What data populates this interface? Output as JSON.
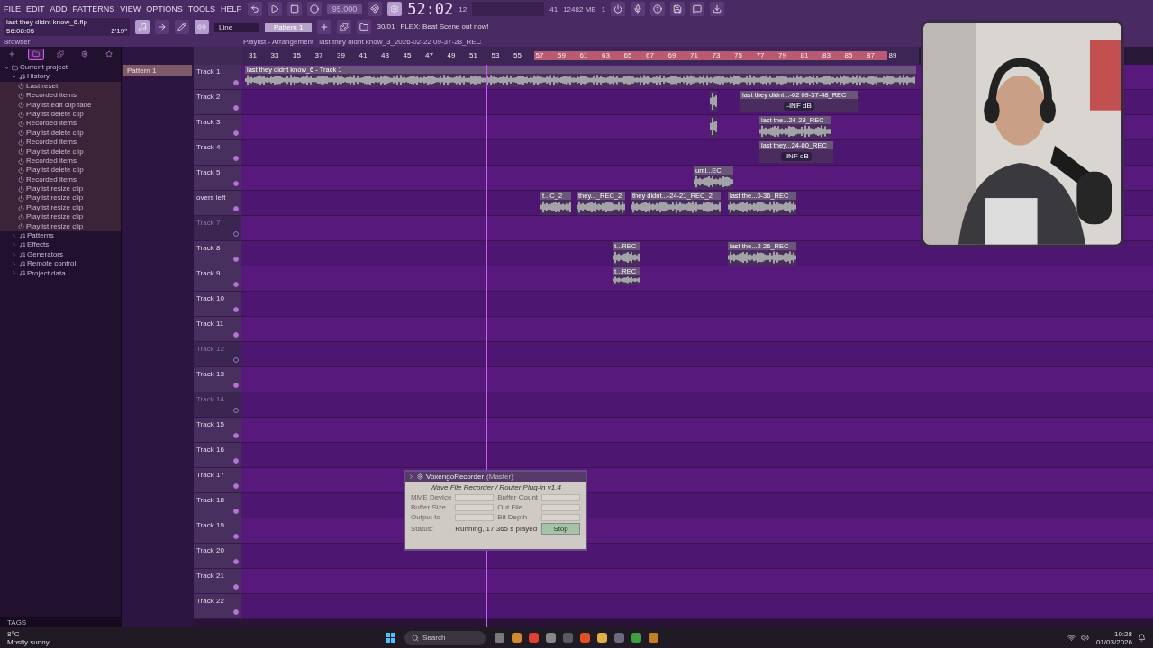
{
  "menu": [
    "FILE",
    "EDIT",
    "ADD",
    "PATTERNS",
    "VIEW",
    "OPTIONS",
    "TOOLS",
    "HELP"
  ],
  "transport": {
    "tempo": "95.000",
    "time": "52:02",
    "time_small": "12",
    "cpu": "41",
    "memory": "12482 MB",
    "voices": "1"
  },
  "song": {
    "file": "last they didnt know_6.flp",
    "position": "56:08:05",
    "length": "2'19\""
  },
  "snap": "Line",
  "pattern": "Pattern 1",
  "hint": {
    "date": "30/01",
    "text": "FLEX: Beat Scene out now!"
  },
  "browser": {
    "title": "Browser",
    "tabs": [
      {
        "selected": false
      },
      {
        "selected": true
      },
      {
        "selected": false
      },
      {
        "selected": false
      },
      {
        "selected": false
      }
    ],
    "tree": [
      {
        "label": "Current project",
        "expanded": true,
        "children": [
          {
            "label": "History",
            "expanded": true,
            "children": [
              {
                "label": "Last reset"
              },
              {
                "label": "Recorded items"
              },
              {
                "label": "Playlist edit clip fade"
              },
              {
                "label": "Playlist delete clip"
              },
              {
                "label": "Recorded items"
              },
              {
                "label": "Playlist delete clip"
              },
              {
                "label": "Recorded items"
              },
              {
                "label": "Playlist delete clip"
              },
              {
                "label": "Recorded items"
              },
              {
                "label": "Playlist delete clip"
              },
              {
                "label": "Recorded items"
              },
              {
                "label": "Playlist resize clip"
              },
              {
                "label": "Playlist resize clip"
              },
              {
                "label": "Playlist resize clip"
              },
              {
                "label": "Playlist resize clip"
              },
              {
                "label": "Playlist resize clip"
              }
            ]
          },
          {
            "label": "Patterns",
            "expanded": false
          },
          {
            "label": "Effects",
            "expanded": false
          },
          {
            "label": "Generators",
            "expanded": false
          },
          {
            "label": "Remote control",
            "expanded": false
          },
          {
            "label": "Project data",
            "expanded": false
          }
        ]
      }
    ],
    "tags": "TAGS"
  },
  "patterns": [
    {
      "label": "Pattern 1",
      "selected": true
    }
  ],
  "playlist": {
    "title": "Playlist - Arrangement",
    "path": "last they didnt know_3_2026-02-22 09-37-28_REC",
    "ruler": [
      {
        "label": "31",
        "in_loop": false
      },
      {
        "label": "33",
        "in_loop": false
      },
      {
        "label": "35",
        "in_loop": false
      },
      {
        "label": "37",
        "in_loop": false
      },
      {
        "label": "39",
        "in_loop": false
      },
      {
        "label": "41",
        "in_loop": false
      },
      {
        "label": "43",
        "in_loop": false
      },
      {
        "label": "45",
        "in_loop": false
      },
      {
        "label": "47",
        "in_loop": false
      },
      {
        "label": "49",
        "in_loop": false
      },
      {
        "label": "51",
        "in_loop": false
      },
      {
        "label": "53",
        "in_loop": false
      },
      {
        "label": "55",
        "in_loop": false
      },
      {
        "label": "57",
        "in_loop": true
      },
      {
        "label": "59",
        "in_loop": true
      },
      {
        "label": "61",
        "in_loop": true
      },
      {
        "label": "63",
        "in_loop": true
      },
      {
        "label": "65",
        "in_loop": true
      },
      {
        "label": "67",
        "in_loop": true
      },
      {
        "label": "69",
        "in_loop": true
      },
      {
        "label": "71",
        "in_loop": true
      },
      {
        "label": "73",
        "in_loop": true
      },
      {
        "label": "75",
        "in_loop": true
      },
      {
        "label": "77",
        "in_loop": true
      },
      {
        "label": "79",
        "in_loop": true
      },
      {
        "label": "81",
        "in_loop": true
      },
      {
        "label": "83",
        "in_loop": true
      },
      {
        "label": "85",
        "in_loop": true
      },
      {
        "label": "87",
        "in_loop": true
      },
      {
        "label": "89",
        "in_loop": false
      }
    ],
    "tracks": [
      {
        "name": "Track 1",
        "muted": false
      },
      {
        "name": "Track 2",
        "muted": false
      },
      {
        "name": "Track 3",
        "muted": false
      },
      {
        "name": "Track 4",
        "muted": false
      },
      {
        "name": "Track 5",
        "muted": false
      },
      {
        "name": "overs left",
        "muted": false
      },
      {
        "name": "Track 7",
        "muted": true
      },
      {
        "name": "Track 8",
        "muted": false
      },
      {
        "name": "Track 9",
        "muted": false
      },
      {
        "name": "Track 10",
        "muted": false
      },
      {
        "name": "Track 11",
        "muted": false
      },
      {
        "name": "Track 12",
        "muted": true
      },
      {
        "name": "Track 13",
        "muted": false
      },
      {
        "name": "Track 14",
        "muted": true
      },
      {
        "name": "Track 15",
        "muted": false
      },
      {
        "name": "Track 16",
        "muted": false
      },
      {
        "name": "Track 17",
        "muted": false
      },
      {
        "name": "Track 18",
        "muted": false
      },
      {
        "name": "Track 19",
        "muted": false
      },
      {
        "name": "Track 20",
        "muted": false
      },
      {
        "name": "Track 21",
        "muted": false
      },
      {
        "name": "Track 22",
        "muted": false
      }
    ],
    "clips": [
      {
        "kind": "audio",
        "label": "last they didnt know_6 - Track 1"
      },
      {
        "kind": "audio"
      },
      {
        "kind": "automation",
        "label": "last they didnt...-02 09-37-48_REC",
        "note": "-INF dB"
      },
      {
        "kind": "audio"
      },
      {
        "kind": "audio",
        "label": "last the...24-23_REC"
      },
      {
        "kind": "automation",
        "label": "last they...24-00_REC",
        "note": "-INF dB"
      },
      {
        "kind": "audio",
        "label": "unti...EC"
      },
      {
        "kind": "audio",
        "label": "t...C_2"
      },
      {
        "kind": "audio",
        "label": "they..._REC_2"
      },
      {
        "kind": "audio",
        "label": "they didnt...-24-21_REC_2"
      },
      {
        "kind": "audio",
        "label": "last the...0-36_REC"
      },
      {
        "kind": "audio",
        "label": "t...REC"
      },
      {
        "kind": "audio",
        "label": "last the...2-26_REC"
      },
      {
        "kind": "audio",
        "label": "t...REC"
      }
    ]
  },
  "recorder": {
    "title": "VoxengoRecorder",
    "owner": "(Master)",
    "heading": "Wave File Recorder / Router Plug-in v1.4",
    "fields": [
      {
        "label": "MME Device"
      },
      {
        "label": "Buffer Count"
      },
      {
        "label": "Buffer Size"
      },
      {
        "label": "Out File"
      },
      {
        "label": "Output to"
      },
      {
        "label": "Bit Depth"
      }
    ],
    "status_label": "Status:",
    "status": "Running, 17.365 s played",
    "button": "Stop"
  },
  "taskbar": {
    "temperature": "8°C",
    "weather": "Mostly sunny",
    "search": "Search",
    "time": "10:28",
    "date": "01/03/2026"
  }
}
